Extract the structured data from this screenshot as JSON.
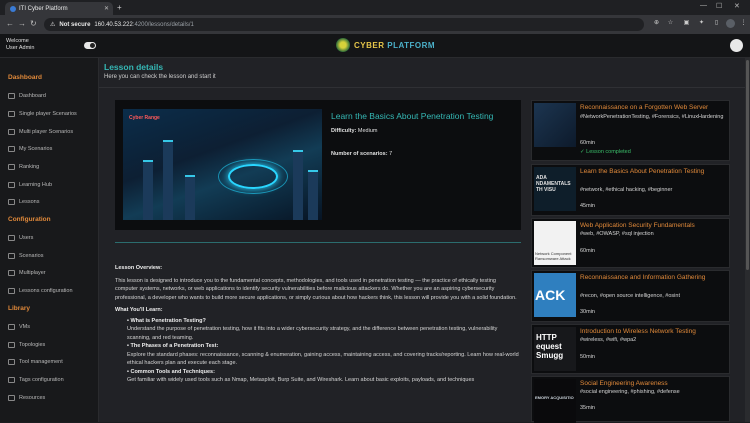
{
  "browser": {
    "tab_title": "ITI Cyber Platform",
    "new_tab": "+",
    "url_security": "Not secure",
    "url_host": "160.40.53.222",
    "url_path": ":4200/lessons/details/1"
  },
  "header": {
    "welcome": "Welcome",
    "user": "User Admin",
    "logo_text_a": "CYBER",
    "logo_text_b": " PLATFORM"
  },
  "sidebar": {
    "sections": [
      {
        "title": "Dashboard",
        "items": [
          "Dashboard",
          "Single player Scenarios",
          "Multi player Scenarios",
          "My Scenarios",
          "Ranking",
          "Learning Hub",
          "Lessons"
        ]
      },
      {
        "title": "Configuration",
        "items": [
          "Users",
          "Scenarios",
          "Multiplayer",
          "Lessons configuration"
        ]
      },
      {
        "title": "Library",
        "items": [
          "VMs",
          "Topologies",
          "Tool management",
          "Tags configuration",
          "Resources"
        ]
      }
    ]
  },
  "page": {
    "title": "Lesson details",
    "subtitle": "Here you can check the lesson and start it"
  },
  "lesson": {
    "image_label": "Cyber Range",
    "title": "Learn the Basics About Penetration Testing",
    "difficulty_label": "Difficulty:",
    "difficulty": "Medium",
    "scenarios_label": "Number of scenarios:",
    "scenarios": "7",
    "overview_heading": "Lesson Overview:",
    "overview": "This lesson is designed to introduce you to the fundamental concepts, methodologies, and tools used in penetration testing — the practice of ethically testing computer systems, networks, or web applications to identify security vulnerabilities before malicious attackers do. Whether you are an aspiring cybersecurity professional, a developer who wants to build more secure applications, or simply curious about how hackers think, this lesson will provide you with a solid foundation.",
    "learn_heading": "What You'll Learn:",
    "learn": [
      {
        "h": "What is Penetration Testing?",
        "t": "Understand the purpose of penetration testing, how it fits into a wider cybersecurity strategy, and the difference between penetration testing, vulnerability scanning, and red teaming."
      },
      {
        "h": "The Phases of a Penetration Test:",
        "t": "Explore the standard phases: reconnaissance, scanning & enumeration, gaining access, maintaining access, and covering tracks/reporting. Learn how real-world ethical hackers plan and execute each stage."
      },
      {
        "h": "Common Tools and Techniques:",
        "t": "Get familiar with widely used tools such as Nmap, Metasploit, Burp Suite, and Wireshark. Learn about basic exploits, payloads, and techniques"
      }
    ]
  },
  "related": [
    {
      "title": "Reconnaissance on a Forgotten Web Server",
      "tags": "#NetworkPenetrationTesting, #Forensics, #LinuxHardening",
      "duration": "60min",
      "status": "✓ Lesson completed",
      "thumb_text": ""
    },
    {
      "title": "Learn the Basics About Penetration Testing",
      "tags": "#network, #ethical hacking, #beginner",
      "duration": "45min",
      "status": "",
      "thumb_text": "ADA NDAMENTALS TH VISU"
    },
    {
      "title": "Web Application Security Fundamentals",
      "tags": "#web, #OWASP, #sql injection",
      "duration": "60min",
      "status": "",
      "thumb_text": "Network Component Ransomware Attack"
    },
    {
      "title": "Reconnaissance and Information Gathering",
      "tags": "#recon, #open source intelligence, #osint",
      "duration": "30min",
      "status": "",
      "thumb_text": "ACK"
    },
    {
      "title": "Introduction to Wireless Network Testing",
      "tags": "#wireless, #wifi, #wpa2",
      "duration": "50min",
      "status": "",
      "thumb_text": "HTTP equest Smugg"
    },
    {
      "title": "Social Engineering Awareness",
      "tags": "#social engineering, #phishing, #defense",
      "duration": "35min",
      "status": "",
      "thumb_text": "EMORY ACQUISITIO"
    }
  ],
  "colors": {
    "accent_teal": "#35b8b5",
    "accent_orange": "#e0893a",
    "success_green": "#3bbf6a"
  }
}
